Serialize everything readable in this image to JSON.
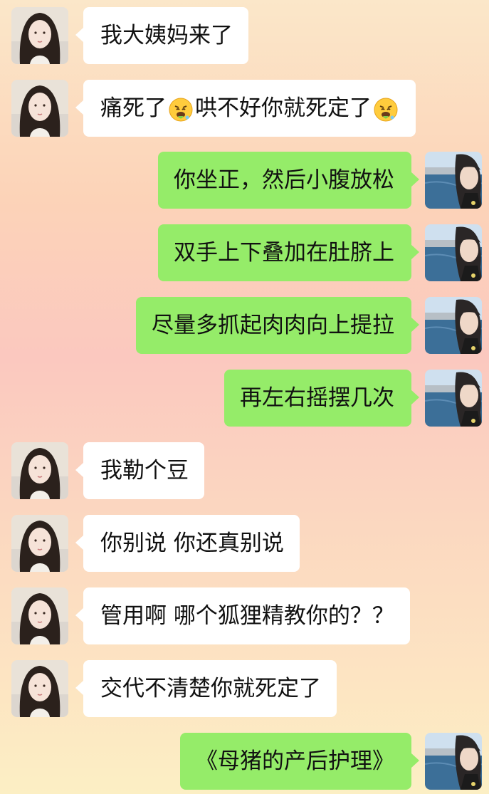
{
  "chat": {
    "messages": [
      {
        "side": "left",
        "text": "我大姨妈来了"
      },
      {
        "side": "left",
        "parts": [
          "痛死了",
          "[emoji]",
          "哄不好你就死定了",
          "[emoji]"
        ],
        "emoji": "angry-vomit-face-icon"
      },
      {
        "side": "right",
        "text": "你坐正，然后小腹放松"
      },
      {
        "side": "right",
        "text": "双手上下叠加在肚脐上"
      },
      {
        "side": "right",
        "text": "尽量多抓起肉肉向上提拉"
      },
      {
        "side": "right",
        "text": "再左右摇摆几次"
      },
      {
        "side": "left",
        "text": "我勒个豆"
      },
      {
        "side": "left",
        "text": "你别说 你还真别说"
      },
      {
        "side": "left",
        "text": "管用啊 哪个狐狸精教你的？？"
      },
      {
        "side": "left",
        "text": "交代不清楚你就死定了"
      },
      {
        "side": "right",
        "text": "《母猪的产后护理》"
      }
    ]
  },
  "colors": {
    "incoming_bubble": "#ffffff",
    "outgoing_bubble": "#95ec69",
    "text": "#111111"
  }
}
